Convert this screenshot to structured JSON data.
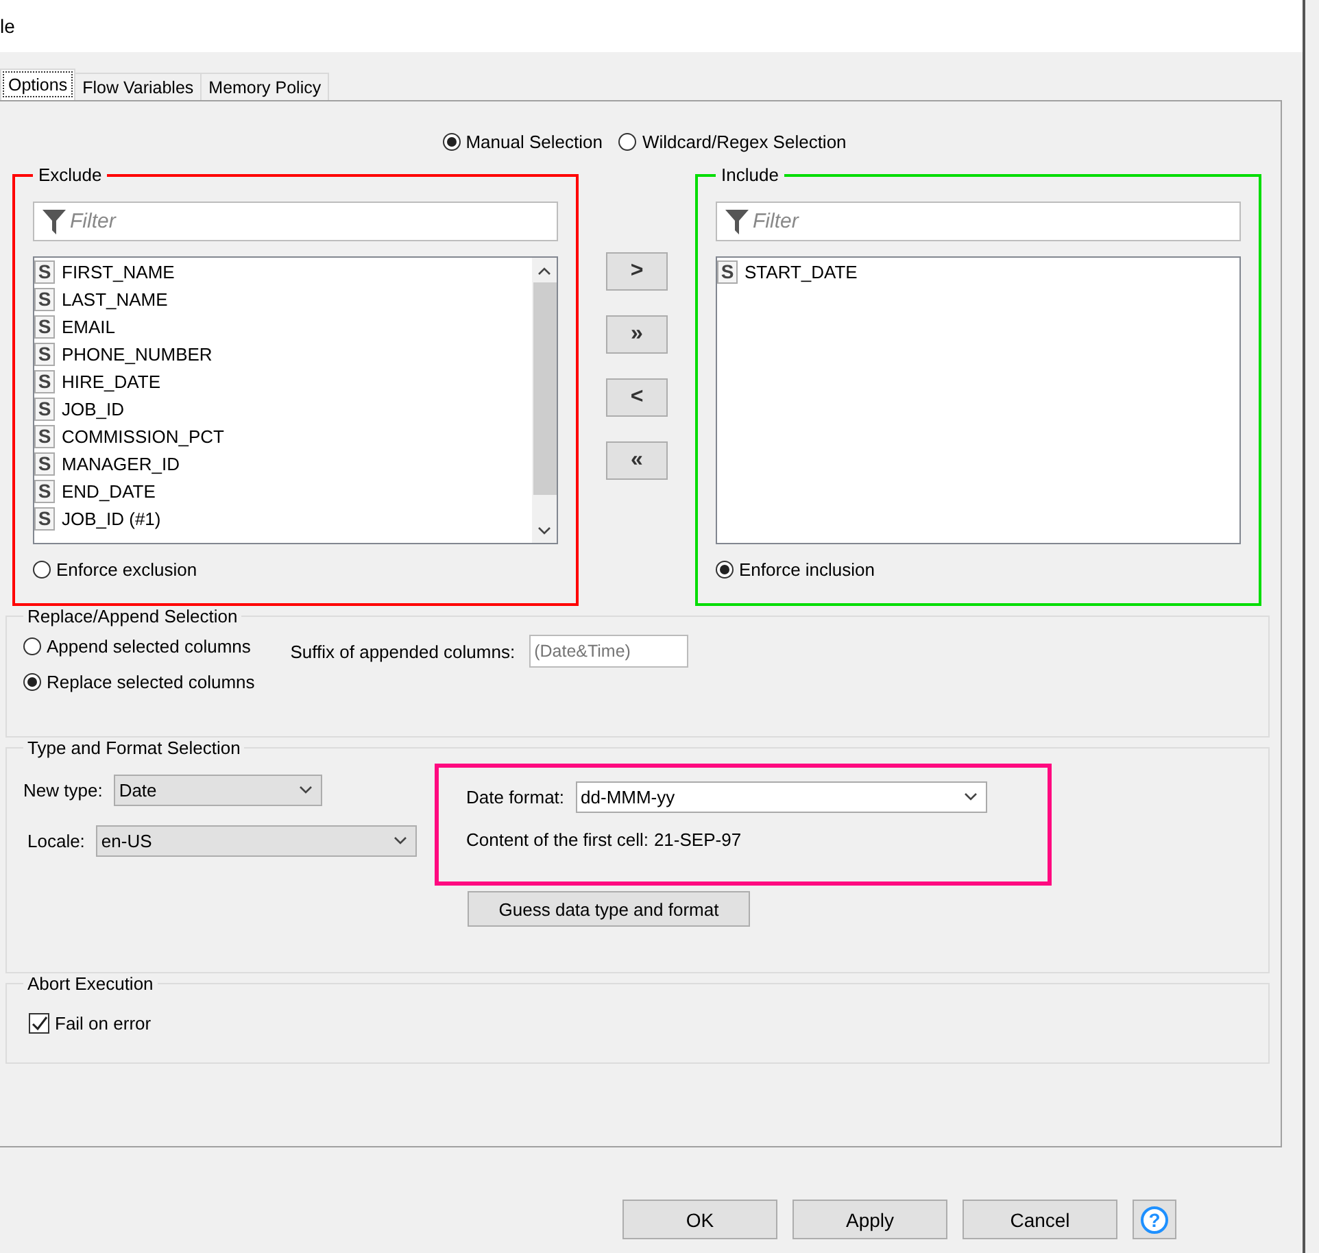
{
  "window": {
    "title": "le"
  },
  "tabs": [
    {
      "label": "Options",
      "selected": true
    },
    {
      "label": "Flow Variables",
      "selected": false
    },
    {
      "label": "Memory Policy",
      "selected": false
    }
  ],
  "column_selection": {
    "modes": [
      {
        "label": "Manual Selection",
        "selected": true
      },
      {
        "label": "Wildcard/Regex Selection",
        "selected": false
      }
    ],
    "exclude": {
      "title": "Exclude",
      "filter_placeholder": "Filter",
      "columns": [
        {
          "type_badge": "S",
          "name": "FIRST_NAME"
        },
        {
          "type_badge": "S",
          "name": "LAST_NAME"
        },
        {
          "type_badge": "S",
          "name": "EMAIL"
        },
        {
          "type_badge": "S",
          "name": "PHONE_NUMBER"
        },
        {
          "type_badge": "S",
          "name": "HIRE_DATE"
        },
        {
          "type_badge": "S",
          "name": "JOB_ID"
        },
        {
          "type_badge": "S",
          "name": "COMMISSION_PCT"
        },
        {
          "type_badge": "S",
          "name": "MANAGER_ID"
        },
        {
          "type_badge": "S",
          "name": "END_DATE"
        },
        {
          "type_badge": "S",
          "name": "JOB_ID (#1)"
        }
      ],
      "enforce": {
        "label": "Enforce exclusion",
        "selected": false
      }
    },
    "move_buttons": [
      ">",
      "»",
      "<",
      "«"
    ],
    "include": {
      "title": "Include",
      "filter_placeholder": "Filter",
      "columns": [
        {
          "type_badge": "S",
          "name": "START_DATE"
        }
      ],
      "enforce": {
        "label": "Enforce inclusion",
        "selected": true
      }
    }
  },
  "replace_append": {
    "title": "Replace/Append Selection",
    "options": [
      {
        "label": "Append selected columns",
        "selected": false
      },
      {
        "label": "Replace selected columns",
        "selected": true
      }
    ],
    "suffix": {
      "label": "Suffix of appended columns:",
      "placeholder": "(Date&Time)"
    }
  },
  "type_format": {
    "title": "Type and Format Selection",
    "new_type": {
      "label": "New type:",
      "value": "Date"
    },
    "locale": {
      "label": "Locale:",
      "value": "en-US"
    },
    "date_format": {
      "label": "Date format:",
      "value": "dd-MMM-yy"
    },
    "first_cell": {
      "label": "Content of the first cell:",
      "value": "21-SEP-97"
    },
    "guess_button": "Guess data type and format"
  },
  "abort": {
    "title": "Abort Execution",
    "fail_on_error": {
      "label": "Fail on error",
      "checked": true
    }
  },
  "buttons": [
    "OK",
    "Apply",
    "Cancel"
  ],
  "help_button": {
    "glyph": "?"
  }
}
